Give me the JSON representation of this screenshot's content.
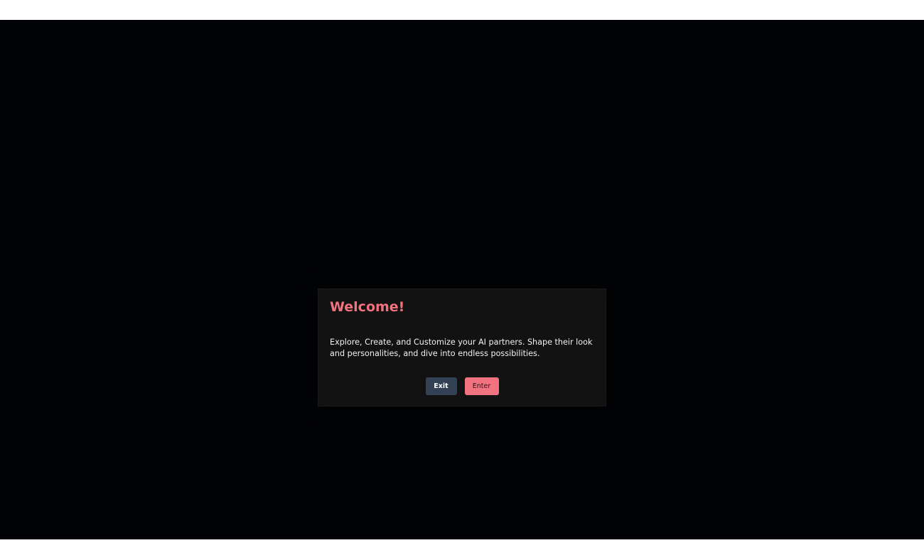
{
  "modal": {
    "title": "Welcome!",
    "body": "Explore, Create, and Customize your AI partners. Shape their look and personalities, and dive into endless possibilities.",
    "exit_label": "Exit",
    "enter_label": "Enter"
  },
  "colors": {
    "accent": "#f2727f",
    "exit_button": "#334155",
    "backdrop": "#020306",
    "modal_background": "#121212"
  }
}
